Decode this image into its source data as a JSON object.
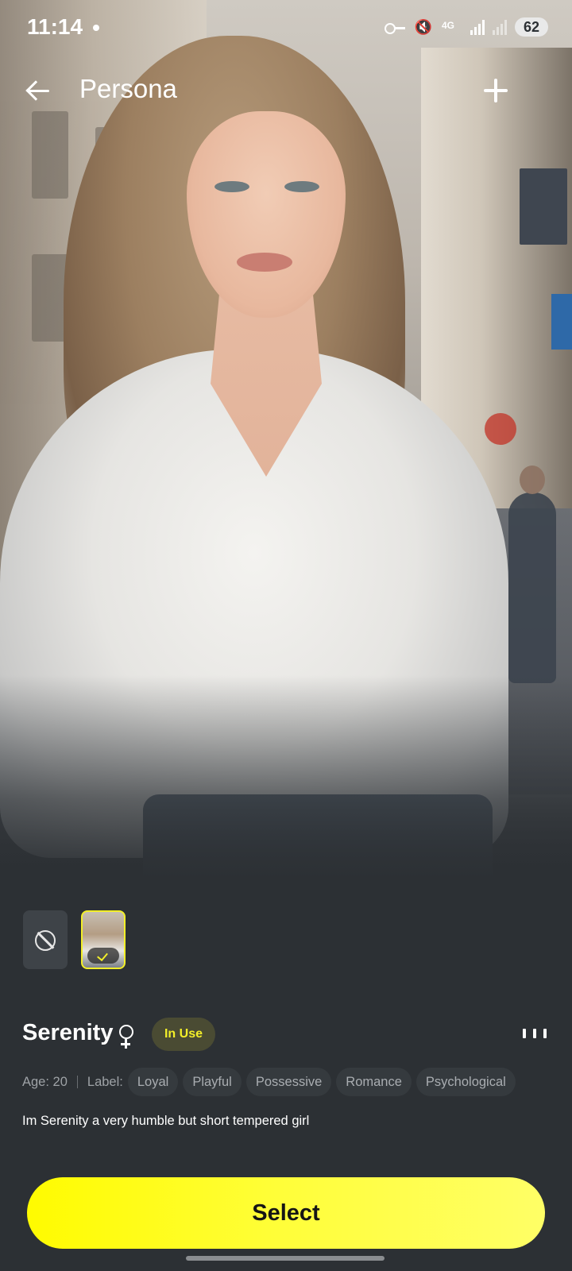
{
  "status_bar": {
    "time": "11:14",
    "network": "4G",
    "battery": "62",
    "icons": [
      "notification-dot-icon",
      "vpn-key-icon",
      "mute-icon",
      "signal-4g-icon",
      "signal-icon",
      "battery-icon"
    ]
  },
  "header": {
    "title": "Persona",
    "back_icon": "arrow-left-icon",
    "add_icon": "plus-icon"
  },
  "persona": {
    "thumbnails": [
      {
        "type": "none",
        "icon": "no-image-icon"
      },
      {
        "type": "image",
        "selected": true,
        "icon": "check-icon"
      }
    ],
    "name": "Serenity",
    "gender_icon": "female-icon",
    "status_badge": "In Use",
    "more_icon": "more-vertical-dots-icon",
    "age": "Age: 20",
    "label_title": "Label:",
    "tags": [
      "Loyal",
      "Playful",
      "Possessive",
      "Romance",
      "Psychological"
    ],
    "bio": "Im Serenity a very humble but short tempered girl"
  },
  "actions": {
    "select_label": "Select"
  },
  "colors": {
    "accent": "#f3ef29",
    "button": "#fffb00",
    "background": "#2c3034"
  }
}
